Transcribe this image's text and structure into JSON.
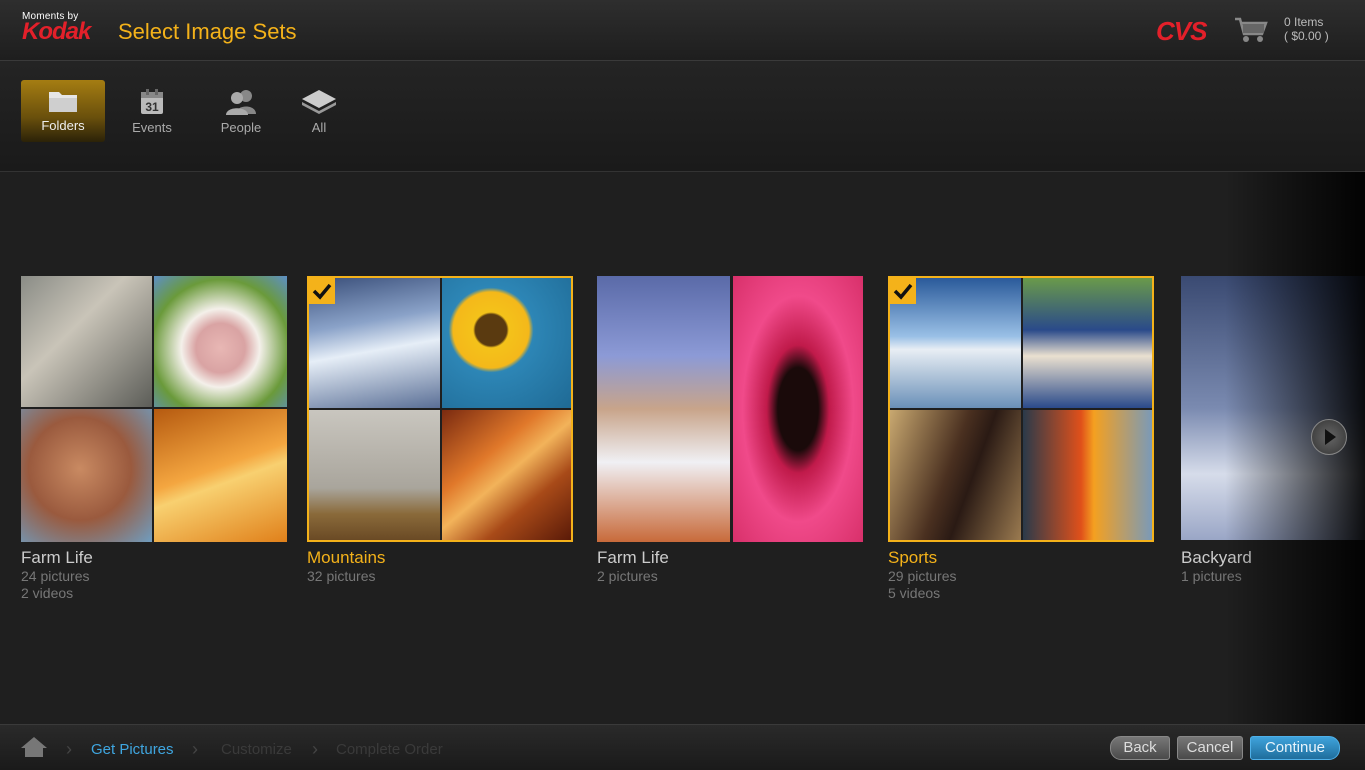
{
  "header": {
    "brand_small": "Moments by",
    "brand_name": "Kodak",
    "page_title": "Select Image Sets",
    "store_logo": "CVS",
    "cart_items": "0 Items",
    "cart_total": "( $0.00 )"
  },
  "filters": [
    {
      "label": "Folders",
      "icon": "folder-icon",
      "active": true
    },
    {
      "label": "Events",
      "icon": "calendar-icon",
      "calendar_day": "31"
    },
    {
      "label": "People",
      "icon": "people-icon"
    },
    {
      "label": "All",
      "icon": "stack-icon"
    }
  ],
  "sets": [
    {
      "title": "Farm Life",
      "pictures": "24 pictures",
      "videos": "2 videos",
      "selected": false,
      "tiles": [
        "cyclists",
        "cow",
        "crying baby",
        "desert road"
      ]
    },
    {
      "title": "Mountains",
      "pictures": "32 pictures",
      "videos": "",
      "selected": true,
      "tiles": [
        "snowy mountains",
        "sunflower",
        "foggy tree",
        "canyon"
      ]
    },
    {
      "title": "Farm Life",
      "pictures": "2 pictures",
      "videos": "",
      "selected": false,
      "tiles": [
        "boy at keyboard",
        "pink flower"
      ]
    },
    {
      "title": "Sports",
      "pictures": "29 pictures",
      "videos": "5 videos",
      "selected": true,
      "tiles": [
        "sky reflection",
        "softball team",
        "man drinking",
        "firefighter"
      ]
    },
    {
      "title": "Backyard",
      "pictures": "1 pictures",
      "videos": "",
      "selected": false,
      "tiles": [
        "snowy tree"
      ]
    }
  ],
  "footer": {
    "crumbs": [
      "Get Pictures",
      "Customize",
      "Complete Order"
    ],
    "back": "Back",
    "cancel": "Cancel",
    "continue": "Continue"
  },
  "colors": {
    "accent": "#f4b21a",
    "brand_red": "#e3202a",
    "link_blue": "#3fa6e0"
  }
}
